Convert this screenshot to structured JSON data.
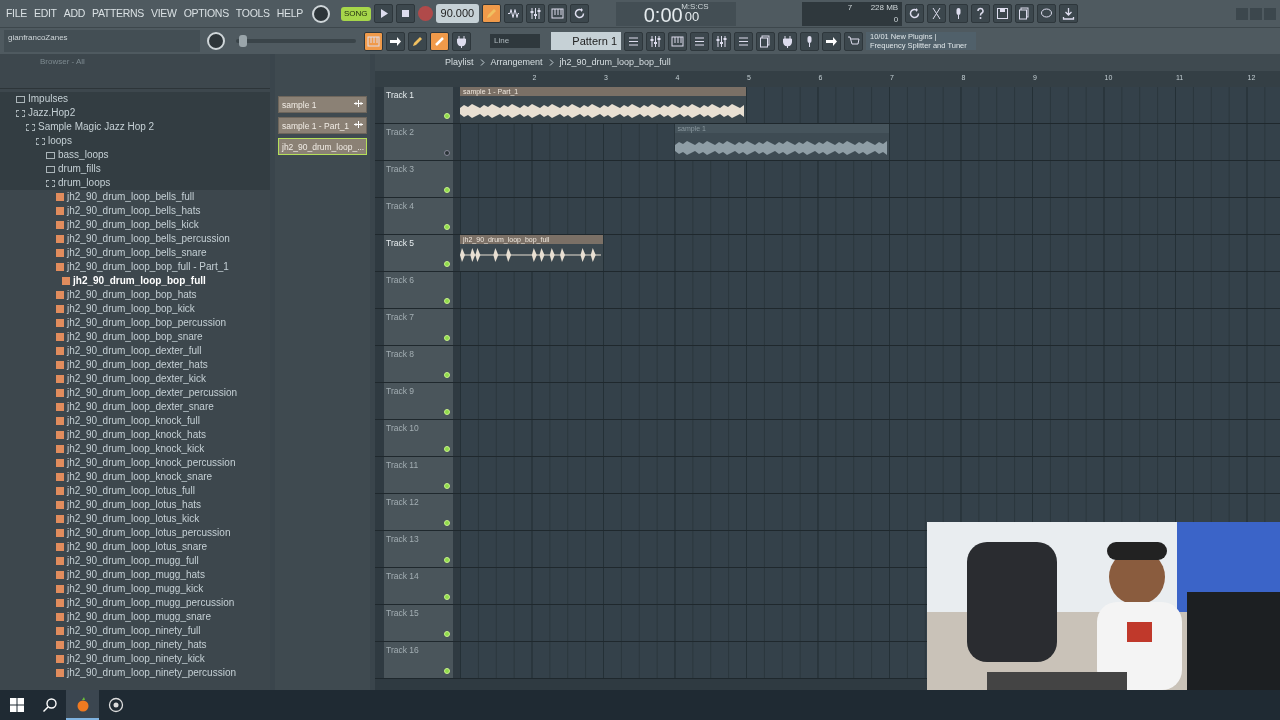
{
  "menu": [
    "FILE",
    "EDIT",
    "ADD",
    "PATTERNS",
    "VIEW",
    "OPTIONS",
    "TOOLS",
    "HELP"
  ],
  "transport": {
    "song_label": "SONG",
    "song_mode": true,
    "tempo": "90.000",
    "recording": false
  },
  "time": {
    "value": "0:00",
    "sub": "00",
    "unit": "M:S:CS"
  },
  "monitor": {
    "voices": "7",
    "memory": "228 MB",
    "cpu": "0"
  },
  "user": "gianfrancoZanes",
  "master_slider": {
    "level": 0.03
  },
  "snap": "Line",
  "pattern": "Pattern 1",
  "news": {
    "date": "10/01",
    "title": "New Plugins |",
    "subtitle": "Frequency Splitter and Tuner"
  },
  "browser": {
    "title": "Browser - All",
    "tree": [
      {
        "kind": "folder",
        "name": "Impulses",
        "expanded": false,
        "selected": false
      },
      {
        "kind": "folder",
        "name": "Jazz.Hop2",
        "expanded": true,
        "selected": false,
        "children": [
          {
            "kind": "folder",
            "name": "Sample Magic Jazz Hop 2",
            "expanded": true,
            "selected": false,
            "children": [
              {
                "kind": "folder",
                "name": "loops",
                "expanded": true,
                "selected": false,
                "children": [
                  {
                    "kind": "folder",
                    "name": "bass_loops",
                    "expanded": false,
                    "selected": false
                  },
                  {
                    "kind": "folder",
                    "name": "drum_fills",
                    "expanded": false,
                    "selected": false
                  },
                  {
                    "kind": "folder",
                    "name": "drum_loops",
                    "expanded": true,
                    "selected": false,
                    "children": [
                      {
                        "kind": "file",
                        "name": "jh2_90_drum_loop_bells_full",
                        "selected": false
                      },
                      {
                        "kind": "file",
                        "name": "jh2_90_drum_loop_bells_hats",
                        "selected": false
                      },
                      {
                        "kind": "file",
                        "name": "jh2_90_drum_loop_bells_kick",
                        "selected": false
                      },
                      {
                        "kind": "file",
                        "name": "jh2_90_drum_loop_bells_percussion",
                        "selected": false
                      },
                      {
                        "kind": "file",
                        "name": "jh2_90_drum_loop_bells_snare",
                        "selected": false
                      },
                      {
                        "kind": "file",
                        "name": "jh2_90_drum_loop_bop_full - Part_1",
                        "selected": false
                      },
                      {
                        "kind": "file",
                        "name": "jh2_90_drum_loop_bop_full",
                        "selected": true
                      },
                      {
                        "kind": "file",
                        "name": "jh2_90_drum_loop_bop_hats",
                        "selected": false
                      },
                      {
                        "kind": "file",
                        "name": "jh2_90_drum_loop_bop_kick",
                        "selected": false
                      },
                      {
                        "kind": "file",
                        "name": "jh2_90_drum_loop_bop_percussion",
                        "selected": false
                      },
                      {
                        "kind": "file",
                        "name": "jh2_90_drum_loop_bop_snare",
                        "selected": false
                      },
                      {
                        "kind": "file",
                        "name": "jh2_90_drum_loop_dexter_full",
                        "selected": false
                      },
                      {
                        "kind": "file",
                        "name": "jh2_90_drum_loop_dexter_hats",
                        "selected": false
                      },
                      {
                        "kind": "file",
                        "name": "jh2_90_drum_loop_dexter_kick",
                        "selected": false
                      },
                      {
                        "kind": "file",
                        "name": "jh2_90_drum_loop_dexter_percussion",
                        "selected": false
                      },
                      {
                        "kind": "file",
                        "name": "jh2_90_drum_loop_dexter_snare",
                        "selected": false
                      },
                      {
                        "kind": "file",
                        "name": "jh2_90_drum_loop_knock_full",
                        "selected": false
                      },
                      {
                        "kind": "file",
                        "name": "jh2_90_drum_loop_knock_hats",
                        "selected": false
                      },
                      {
                        "kind": "file",
                        "name": "jh2_90_drum_loop_knock_kick",
                        "selected": false
                      },
                      {
                        "kind": "file",
                        "name": "jh2_90_drum_loop_knock_percussion",
                        "selected": false
                      },
                      {
                        "kind": "file",
                        "name": "jh2_90_drum_loop_knock_snare",
                        "selected": false
                      },
                      {
                        "kind": "file",
                        "name": "jh2_90_drum_loop_lotus_full",
                        "selected": false
                      },
                      {
                        "kind": "file",
                        "name": "jh2_90_drum_loop_lotus_hats",
                        "selected": false
                      },
                      {
                        "kind": "file",
                        "name": "jh2_90_drum_loop_lotus_kick",
                        "selected": false
                      },
                      {
                        "kind": "file",
                        "name": "jh2_90_drum_loop_lotus_percussion",
                        "selected": false
                      },
                      {
                        "kind": "file",
                        "name": "jh2_90_drum_loop_lotus_snare",
                        "selected": false
                      },
                      {
                        "kind": "file",
                        "name": "jh2_90_drum_loop_mugg_full",
                        "selected": false
                      },
                      {
                        "kind": "file",
                        "name": "jh2_90_drum_loop_mugg_hats",
                        "selected": false
                      },
                      {
                        "kind": "file",
                        "name": "jh2_90_drum_loop_mugg_kick",
                        "selected": false
                      },
                      {
                        "kind": "file",
                        "name": "jh2_90_drum_loop_mugg_percussion",
                        "selected": false
                      },
                      {
                        "kind": "file",
                        "name": "jh2_90_drum_loop_mugg_snare",
                        "selected": false
                      },
                      {
                        "kind": "file",
                        "name": "jh2_90_drum_loop_ninety_full",
                        "selected": false
                      },
                      {
                        "kind": "file",
                        "name": "jh2_90_drum_loop_ninety_hats",
                        "selected": false
                      },
                      {
                        "kind": "file",
                        "name": "jh2_90_drum_loop_ninety_kick",
                        "selected": false
                      },
                      {
                        "kind": "file",
                        "name": "jh2_90_drum_loop_ninety_percussion",
                        "selected": false
                      }
                    ]
                  }
                ]
              }
            ]
          }
        ]
      }
    ]
  },
  "picker": [
    {
      "name": "sample 1",
      "selected": false
    },
    {
      "name": "sample 1 - Part_1",
      "selected": false
    },
    {
      "name": "jh2_90_drum_loop_...",
      "selected": true
    }
  ],
  "playlist": {
    "breadcrumb": [
      "Playlist",
      "Arrangement",
      "jh2_90_drum_loop_bop_full"
    ],
    "bars": [
      "2",
      "3",
      "4",
      "5",
      "6",
      "7",
      "8",
      "9",
      "10",
      "11",
      "12"
    ],
    "tracks": [
      {
        "name": "Track 1",
        "dimmed": false,
        "on": true,
        "clips": [
          {
            "name": "sample 1 - Part_1",
            "muted": false,
            "kind": "long"
          }
        ]
      },
      {
        "name": "Track 2",
        "dimmed": true,
        "on": false,
        "clips": [
          {
            "name": "sample 1",
            "muted": true,
            "kind": "long"
          }
        ]
      },
      {
        "name": "Track 3",
        "dimmed": true,
        "on": true
      },
      {
        "name": "Track 4",
        "dimmed": true,
        "on": true
      },
      {
        "name": "Track 5",
        "dimmed": false,
        "on": true,
        "clips": [
          {
            "name": "jh2_90_drum_loop_bop_full",
            "muted": false,
            "kind": "hits"
          }
        ]
      },
      {
        "name": "Track 6",
        "dimmed": true,
        "on": true
      },
      {
        "name": "Track 7",
        "dimmed": true,
        "on": true
      },
      {
        "name": "Track 8",
        "dimmed": true,
        "on": true
      },
      {
        "name": "Track 9",
        "dimmed": true,
        "on": true
      },
      {
        "name": "Track 10",
        "dimmed": true,
        "on": true
      },
      {
        "name": "Track 11",
        "dimmed": true,
        "on": true
      },
      {
        "name": "Track 12",
        "dimmed": true,
        "on": true
      },
      {
        "name": "Track 13",
        "dimmed": true,
        "on": true
      },
      {
        "name": "Track 14",
        "dimmed": true,
        "on": true
      },
      {
        "name": "Track 15",
        "dimmed": true,
        "on": true
      },
      {
        "name": "Track 16",
        "dimmed": true,
        "on": true
      }
    ]
  }
}
